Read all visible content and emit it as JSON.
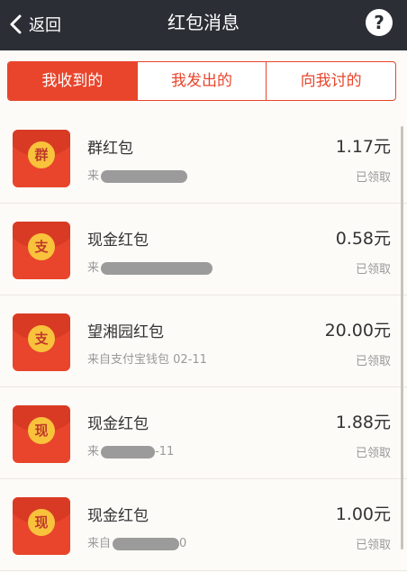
{
  "header": {
    "back_label": "返回",
    "title": "红包消息",
    "help_label": "?"
  },
  "tabs": [
    {
      "label": "我收到的",
      "active": true
    },
    {
      "label": "我发出的",
      "active": false
    },
    {
      "label": "向我讨的",
      "active": false
    }
  ],
  "items": [
    {
      "seal": "群",
      "name": "群红包",
      "from_prefix": "来",
      "from_text": "",
      "amount": "1.17元",
      "status": "已领取"
    },
    {
      "seal": "支",
      "name": "现金红包",
      "from_prefix": "来",
      "from_text": "",
      "amount": "0.58元",
      "status": "已领取"
    },
    {
      "seal": "支",
      "name": "望湘园红包",
      "from_prefix": "来自",
      "from_text": "支付宝钱包 02-11",
      "amount": "20.00元",
      "status": "已领取"
    },
    {
      "seal": "现",
      "name": "现金红包",
      "from_prefix": "来",
      "from_text": "-11",
      "amount": "1.88元",
      "status": "已领取"
    },
    {
      "seal": "现",
      "name": "现金红包",
      "from_prefix": "来自",
      "from_text": "0",
      "amount": "1.00元",
      "status": "已领取"
    }
  ],
  "colors": {
    "accent": "#e8452c",
    "header_bg": "#2b2e35",
    "seal": "#f9c23c"
  },
  "icons": {
    "back": "chevron-left-icon",
    "help": "question-mark-icon"
  }
}
